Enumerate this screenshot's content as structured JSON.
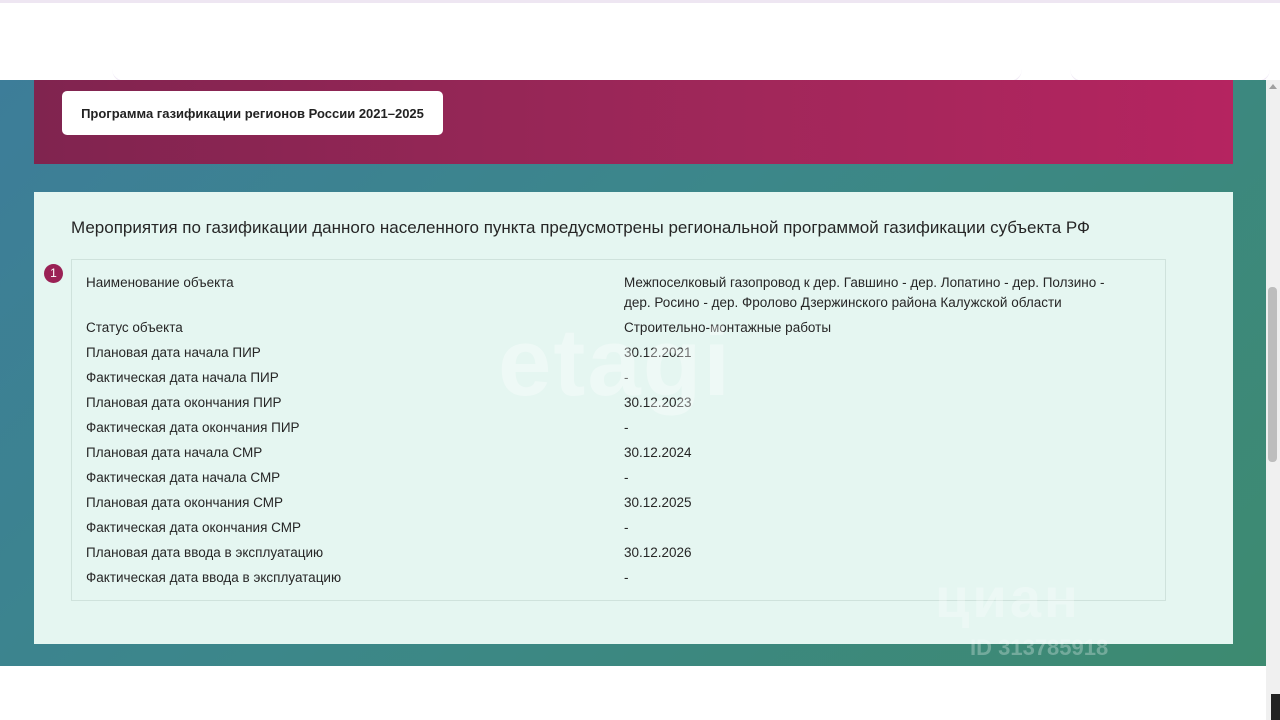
{
  "banner": {
    "program_button_label": "Программа газификации регионов России 2021–2025"
  },
  "panel": {
    "title": "Мероприятия по газификации данного населенного пункта предусмотрены региональной программой газификации субъекта РФ",
    "badge_number": "1",
    "rows": [
      {
        "label": "Наименование объекта",
        "value": "Межпоселковый газопровод к дер. Гавшино - дер. Лопатино - дер. Ползино - дер. Росино - дер. Фролово Дзержинского района Калужской области"
      },
      {
        "label": "Статус объекта",
        "value": "Строительно-монтажные работы"
      },
      {
        "label": "Плановая дата начала ПИР",
        "value": "30.12.2021"
      },
      {
        "label": "Фактическая дата начала ПИР",
        "value": "-"
      },
      {
        "label": "Плановая дата окончания ПИР",
        "value": "30.12.2023"
      },
      {
        "label": "Фактическая дата окончания ПИР",
        "value": "-"
      },
      {
        "label": "Плановая дата начала СМР",
        "value": "30.12.2024"
      },
      {
        "label": "Фактическая дата начала СМР",
        "value": "-"
      },
      {
        "label": "Плановая дата окончания СМР",
        "value": "30.12.2025"
      },
      {
        "label": "Фактическая дата окончания СМР",
        "value": "-"
      },
      {
        "label": "Плановая дата ввода в эксплуатацию",
        "value": "30.12.2026"
      },
      {
        "label": "Фактическая дата ввода в эксплуатацию",
        "value": "-"
      }
    ]
  },
  "watermarks": {
    "etagi": "etagi",
    "cian": "циан",
    "cian_id": "ID 313785918"
  },
  "colors": {
    "banner_start": "#80244f",
    "banner_end": "#b52460",
    "panel_bg": "#e5f6f1",
    "backdrop": "#3c878a",
    "badge": "#9a2155"
  }
}
